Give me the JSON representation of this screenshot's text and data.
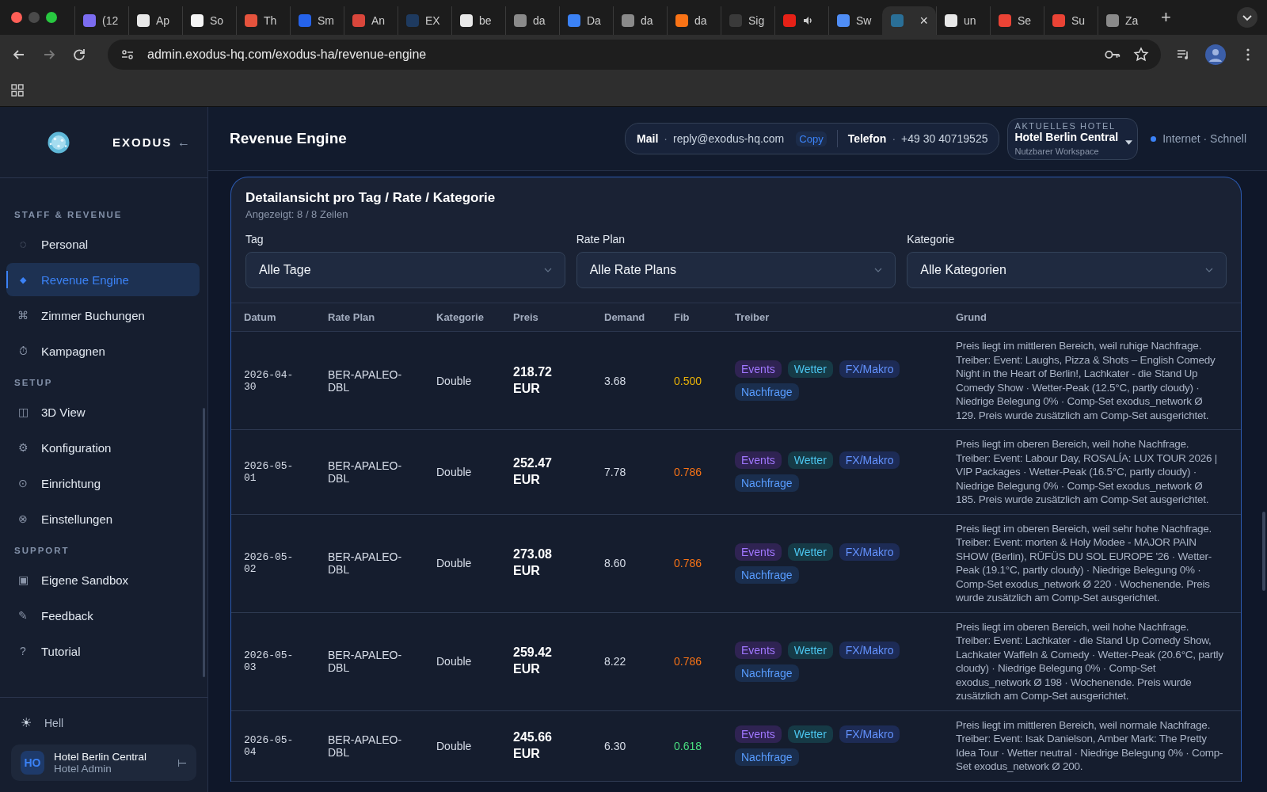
{
  "browser": {
    "tabs": [
      {
        "label": "(12",
        "color": "#7b6cf0",
        "selected": false
      },
      {
        "label": "Ap",
        "color": "#e8e8e8",
        "selected": false
      },
      {
        "label": "So",
        "color": "#f5f5f5",
        "selected": false
      },
      {
        "label": "Th",
        "color": "#e5533d",
        "selected": false
      },
      {
        "label": "Sm",
        "color": "#2563eb",
        "selected": false
      },
      {
        "label": "An",
        "color": "#d9463b",
        "selected": false
      },
      {
        "label": "EX",
        "color": "#1e3a5f",
        "selected": false
      },
      {
        "label": "be",
        "color": "#e8e8e8",
        "selected": false
      },
      {
        "label": "da",
        "color": "#8a8a8a",
        "selected": false
      },
      {
        "label": "Da",
        "color": "#3b82f6",
        "selected": false
      },
      {
        "label": "da",
        "color": "#8a8a8a",
        "selected": false
      },
      {
        "label": "da",
        "color": "#f97316",
        "selected": false
      },
      {
        "label": "Sig",
        "color": "#3a3a3a",
        "selected": false
      },
      {
        "color": "#e62117",
        "selected": false,
        "audio": true
      },
      {
        "label": "Sw",
        "color": "#4f8df5",
        "selected": false
      },
      {
        "color": "#2a6f97",
        "selected": true,
        "close": "×"
      },
      {
        "label": "un",
        "color": "#e8e8e8",
        "selected": false
      },
      {
        "label": "Se",
        "color": "#ea4335",
        "selected": false
      },
      {
        "label": "Su",
        "color": "#ea4335",
        "selected": false
      },
      {
        "label": "Za",
        "color": "#8a8a8a",
        "selected": false
      }
    ],
    "new_tab": "+",
    "address": "admin.exodus-hq.com/exodus-ha/revenue-engine"
  },
  "sidebar": {
    "brand": "EXODUS",
    "collapse": "←",
    "sections": [
      {
        "title": "STAFF & REVENUE",
        "items": [
          {
            "icon": "◌",
            "label": "Personal",
            "selected": false
          },
          {
            "icon": "◆",
            "label": "Revenue Engine",
            "selected": true
          },
          {
            "icon": "⌘",
            "label": "Zimmer Buchungen",
            "selected": false
          },
          {
            "icon": "⏱",
            "label": "Kampagnen",
            "selected": false
          }
        ]
      },
      {
        "title": "SETUP",
        "items": [
          {
            "icon": "◫",
            "label": "3D View",
            "selected": false
          },
          {
            "icon": "⚙",
            "label": "Konfiguration",
            "selected": false
          },
          {
            "icon": "⊙",
            "label": "Einrichtung",
            "selected": false
          },
          {
            "icon": "⊗",
            "label": "Einstellungen",
            "selected": false
          }
        ]
      },
      {
        "title": "SUPPORT",
        "items": [
          {
            "icon": "▣",
            "label": "Eigene Sandbox",
            "selected": false
          },
          {
            "icon": "✎",
            "label": "Feedback",
            "selected": false
          },
          {
            "icon": "?",
            "label": "Tutorial",
            "selected": false
          }
        ]
      }
    ],
    "theme": {
      "icon": "☀",
      "label": "Hell"
    },
    "user": {
      "initials": "HO",
      "name": "Hotel Berlin Central",
      "role": "Hotel Admin",
      "logout": "⊢"
    }
  },
  "header": {
    "title": "Revenue Engine",
    "contacts": [
      {
        "label": "Mail",
        "separator": "·",
        "value": "reply@exodus-hq.com",
        "action": "Copy"
      },
      {
        "label": "Telefon",
        "separator": "·",
        "value": "+49 30 40719525"
      }
    ],
    "hotel": {
      "caption": "AKTUELLES HOTEL",
      "name": "Hotel Berlin Central",
      "sub": "Nutzbarer Workspace"
    },
    "connection": {
      "label": "Internet · Schnell",
      "online": true
    }
  },
  "card": {
    "title": "Detailansicht pro Tag / Rate / Kategorie",
    "subtitle": "Angezeigt: 8 / 8 Zeilen",
    "filters": [
      {
        "label": "Tag",
        "value": "Alle Tage"
      },
      {
        "label": "Rate Plan",
        "value": "Alle Rate Plans"
      },
      {
        "label": "Kategorie",
        "value": "Alle Kategorien"
      }
    ],
    "columns": [
      "Datum",
      "Rate Plan",
      "Kategorie",
      "Preis",
      "Demand",
      "Fib",
      "Treiber",
      "Grund"
    ],
    "rows": [
      {
        "date": "2026-04-30",
        "rate_plan": "BER-APALEO-DBL",
        "category": "Double",
        "price": "218.72 EUR",
        "demand": "3.68",
        "fib": {
          "value": "0.500",
          "color": "#eab308"
        },
        "drivers": [
          {
            "label": "Events",
            "color": "#2f2352"
          },
          {
            "label": "Wetter",
            "color": "#163a46"
          },
          {
            "label": "FX/Makro",
            "color": "#1d2b55"
          },
          {
            "label": "Nachfrage",
            "color": "#1a2e4e"
          }
        ],
        "reason": "Preis liegt im mittleren Bereich, weil ruhige Nachfrage. Treiber: Event: Laughs, Pizza & Shots – English Comedy Night in the Heart of Berlin!, Lachkater - die Stand Up Comedy Show · Wetter-Peak (12.5°C, partly cloudy) · Niedrige Belegung 0% · Comp-Set exodus_network Ø 129. Preis wurde zusätzlich am Comp-Set ausgerichtet."
      },
      {
        "date": "2026-05-01",
        "rate_plan": "BER-APALEO-DBL",
        "category": "Double",
        "price": "252.47 EUR",
        "demand": "7.78",
        "fib": {
          "value": "0.786",
          "color": "#f97316"
        },
        "drivers": [
          {
            "label": "Events",
            "color": "#2f2352"
          },
          {
            "label": "Wetter",
            "color": "#163a46"
          },
          {
            "label": "FX/Makro",
            "color": "#1d2b55"
          },
          {
            "label": "Nachfrage",
            "color": "#1a2e4e"
          }
        ],
        "reason": "Preis liegt im oberen Bereich, weil hohe Nachfrage. Treiber: Event: Labour Day, ROSALÍA: LUX TOUR 2026 | VIP Packages · Wetter-Peak (16.5°C, partly cloudy) · Niedrige Belegung 0% · Comp-Set exodus_network Ø 185. Preis wurde zusätzlich am Comp-Set ausgerichtet."
      },
      {
        "date": "2026-05-02",
        "rate_plan": "BER-APALEO-DBL",
        "category": "Double",
        "price": "273.08 EUR",
        "demand": "8.60",
        "fib": {
          "value": "0.786",
          "color": "#f97316"
        },
        "drivers": [
          {
            "label": "Events",
            "color": "#2f2352"
          },
          {
            "label": "Wetter",
            "color": "#163a46"
          },
          {
            "label": "FX/Makro",
            "color": "#1d2b55"
          },
          {
            "label": "Nachfrage",
            "color": "#1a2e4e"
          }
        ],
        "reason": "Preis liegt im oberen Bereich, weil sehr hohe Nachfrage. Treiber: Event: morten & Holy Modee - MAJOR PAIN SHOW (Berlin), RÜFÜS DU SOL EUROPE '26 · Wetter-Peak (19.1°C, partly cloudy) · Niedrige Belegung 0% · Comp-Set exodus_network Ø 220 · Wochenende. Preis wurde zusätzlich am Comp-Set ausgerichtet."
      },
      {
        "date": "2026-05-03",
        "rate_plan": "BER-APALEO-DBL",
        "category": "Double",
        "price": "259.42 EUR",
        "demand": "8.22",
        "fib": {
          "value": "0.786",
          "color": "#f97316"
        },
        "drivers": [
          {
            "label": "Events",
            "color": "#2f2352"
          },
          {
            "label": "Wetter",
            "color": "#163a46"
          },
          {
            "label": "FX/Makro",
            "color": "#1d2b55"
          },
          {
            "label": "Nachfrage",
            "color": "#1a2e4e"
          }
        ],
        "reason": "Preis liegt im oberen Bereich, weil hohe Nachfrage. Treiber: Event: Lachkater - die Stand Up Comedy Show, Lachkater Waffeln & Comedy · Wetter-Peak (20.6°C, partly cloudy) · Niedrige Belegung 0% · Comp-Set exodus_network Ø 198 · Wochenende. Preis wurde zusätzlich am Comp-Set ausgerichtet."
      },
      {
        "date": "2026-05-04",
        "rate_plan": "BER-APALEO-DBL",
        "category": "Double",
        "price": "245.66 EUR",
        "demand": "6.30",
        "fib": {
          "value": "0.618",
          "color": "#4ade80"
        },
        "drivers": [
          {
            "label": "Events",
            "color": "#2f2352"
          },
          {
            "label": "Wetter",
            "color": "#163a46"
          },
          {
            "label": "FX/Makro",
            "color": "#1d2b55"
          },
          {
            "label": "Nachfrage",
            "color": "#1a2e4e"
          }
        ],
        "reason": "Preis liegt im mittleren Bereich, weil normale Nachfrage. Treiber: Event: Isak Danielson, Amber Mark: The Pretty Idea Tour · Wetter neutral · Niedrige Belegung 0% · Comp-Set exodus_network Ø 200."
      }
    ]
  }
}
